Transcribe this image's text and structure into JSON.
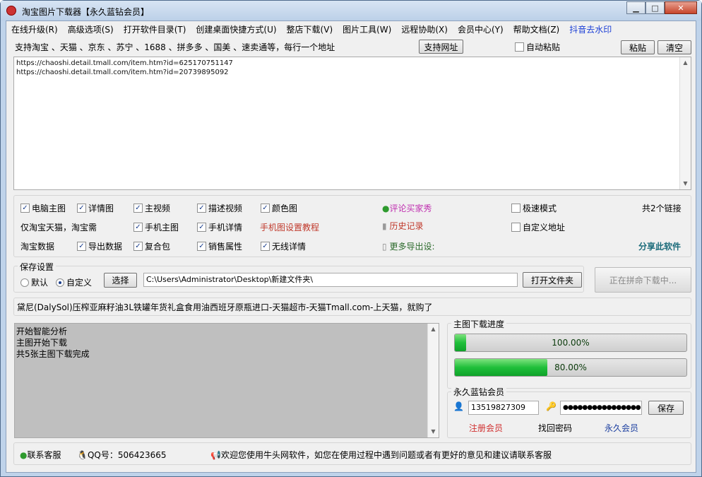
{
  "window": {
    "title": "淘宝图片下载器【永久蓝钻会员】",
    "min": "▁",
    "max": "□",
    "close": "✕"
  },
  "menu": [
    "在线升级(R)",
    "高级选项(S)",
    "打开软件目录(T)",
    "创建桌面快捷方式(U)",
    "整店下载(V)",
    "图片工具(W)",
    "远程协助(X)",
    "会员中心(Y)",
    "帮助文档(Z)"
  ],
  "menu_douyin": "抖音去水印",
  "support_text": "支持淘宝 、天猫 、京东 、苏宁 、1688 、拼多多 、国美 、速卖通等，每行一个地址",
  "btn_support": "支持网址",
  "auto_paste": "自动粘贴",
  "btn_paste": "粘贴",
  "btn_clear": "清空",
  "urls": [
    "https://chaoshi.detail.tmall.com/item.htm?id=625170751147",
    "https://chaoshi.detail.tmall.com/item.htm?id=20739895092"
  ],
  "options": {
    "c1": [
      "电脑主图",
      "详情图",
      "主视频",
      "描述视频",
      "颜色图"
    ],
    "c2": [
      "手机主图",
      "手机详情"
    ],
    "c3": [
      "导出数据",
      "复合包",
      "销售属性",
      "无线详情"
    ],
    "only_tmall": "仅淘宝天猫，淘宝需",
    "taobao_data": "淘宝数据",
    "mobile_tutorial": "手机图设置教程",
    "comment_show": "评论买家秀",
    "history": "历史记录",
    "more_export": "更多导出设:",
    "fast_mode": "极速模式",
    "custom_addr": "自定义地址",
    "link_count": "共2个链接",
    "share": "分享此软件"
  },
  "save": {
    "title": "保存设置",
    "default": "默认",
    "custom": "自定义",
    "btn_select": "选择",
    "path": "C:\\Users\\Administrator\\Desktop\\新建文件夹\\",
    "btn_open": "打开文件夹",
    "btn_busy": "正在拼命下载中..."
  },
  "product_title": "黛尼(DalySol)压榨亚麻籽油3L铁罐年货礼盒食用油西班牙原瓶进口-天猫超市-天猫Tmall.com-上天猫，就购了",
  "log": [
    "开始智能分析",
    "主图开始下载",
    "共5张主图下载完成"
  ],
  "progress": {
    "title": "主图下载进度",
    "p1": "100.00%",
    "p1_value": 0.05,
    "p2": "80.00%",
    "p2_value": 0.4
  },
  "member": {
    "title": "永久蓝钻会员",
    "phone": "13519827309",
    "password": "●●●●●●●●●●●●●●●●",
    "btn_save": "保存",
    "register": "注册会员",
    "find_pwd": "找回密码",
    "forever": "永久会员"
  },
  "statusbar": {
    "contact": "联系客服",
    "qq": "QQ号：506423665",
    "welcome": "欢迎您使用牛头网软件，如您在使用过程中遇到问题或者有更好的意见和建议请联系客服"
  },
  "colors": {
    "green_fill": "#1fbf3a",
    "pink": "#c030b0",
    "red": "#c0392b",
    "teal": "#1b6b7a"
  }
}
